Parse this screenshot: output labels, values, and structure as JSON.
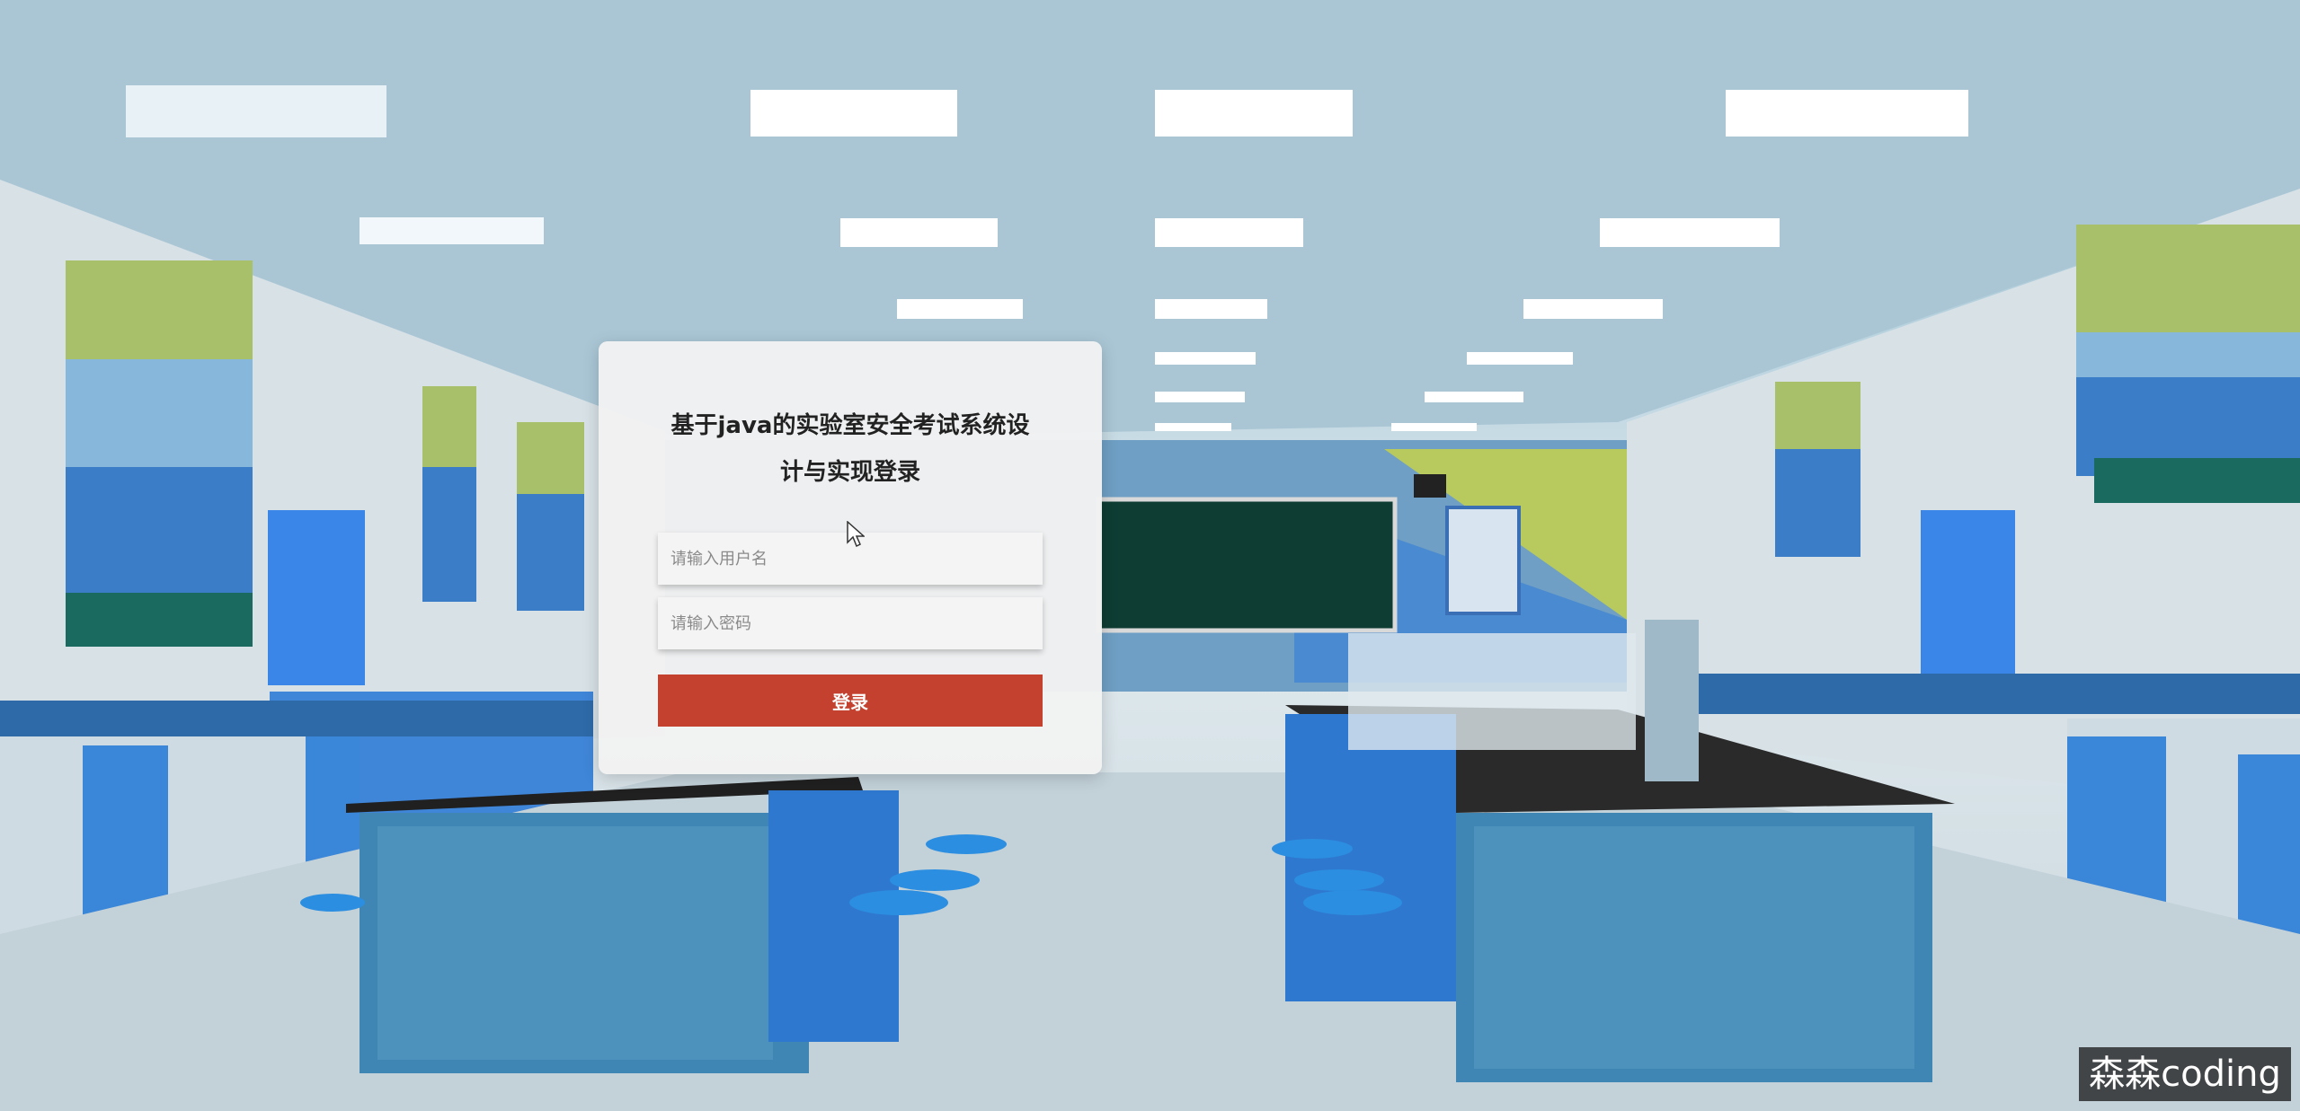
{
  "login": {
    "title": "基于java的实验室安全考试系统设计与实现登录",
    "username_placeholder": "请输入用户名",
    "password_placeholder": "请输入密码",
    "submit_label": "登录"
  },
  "watermark": "森森coding",
  "colors": {
    "button": "#c3412e",
    "card": "#f2f2f2"
  }
}
